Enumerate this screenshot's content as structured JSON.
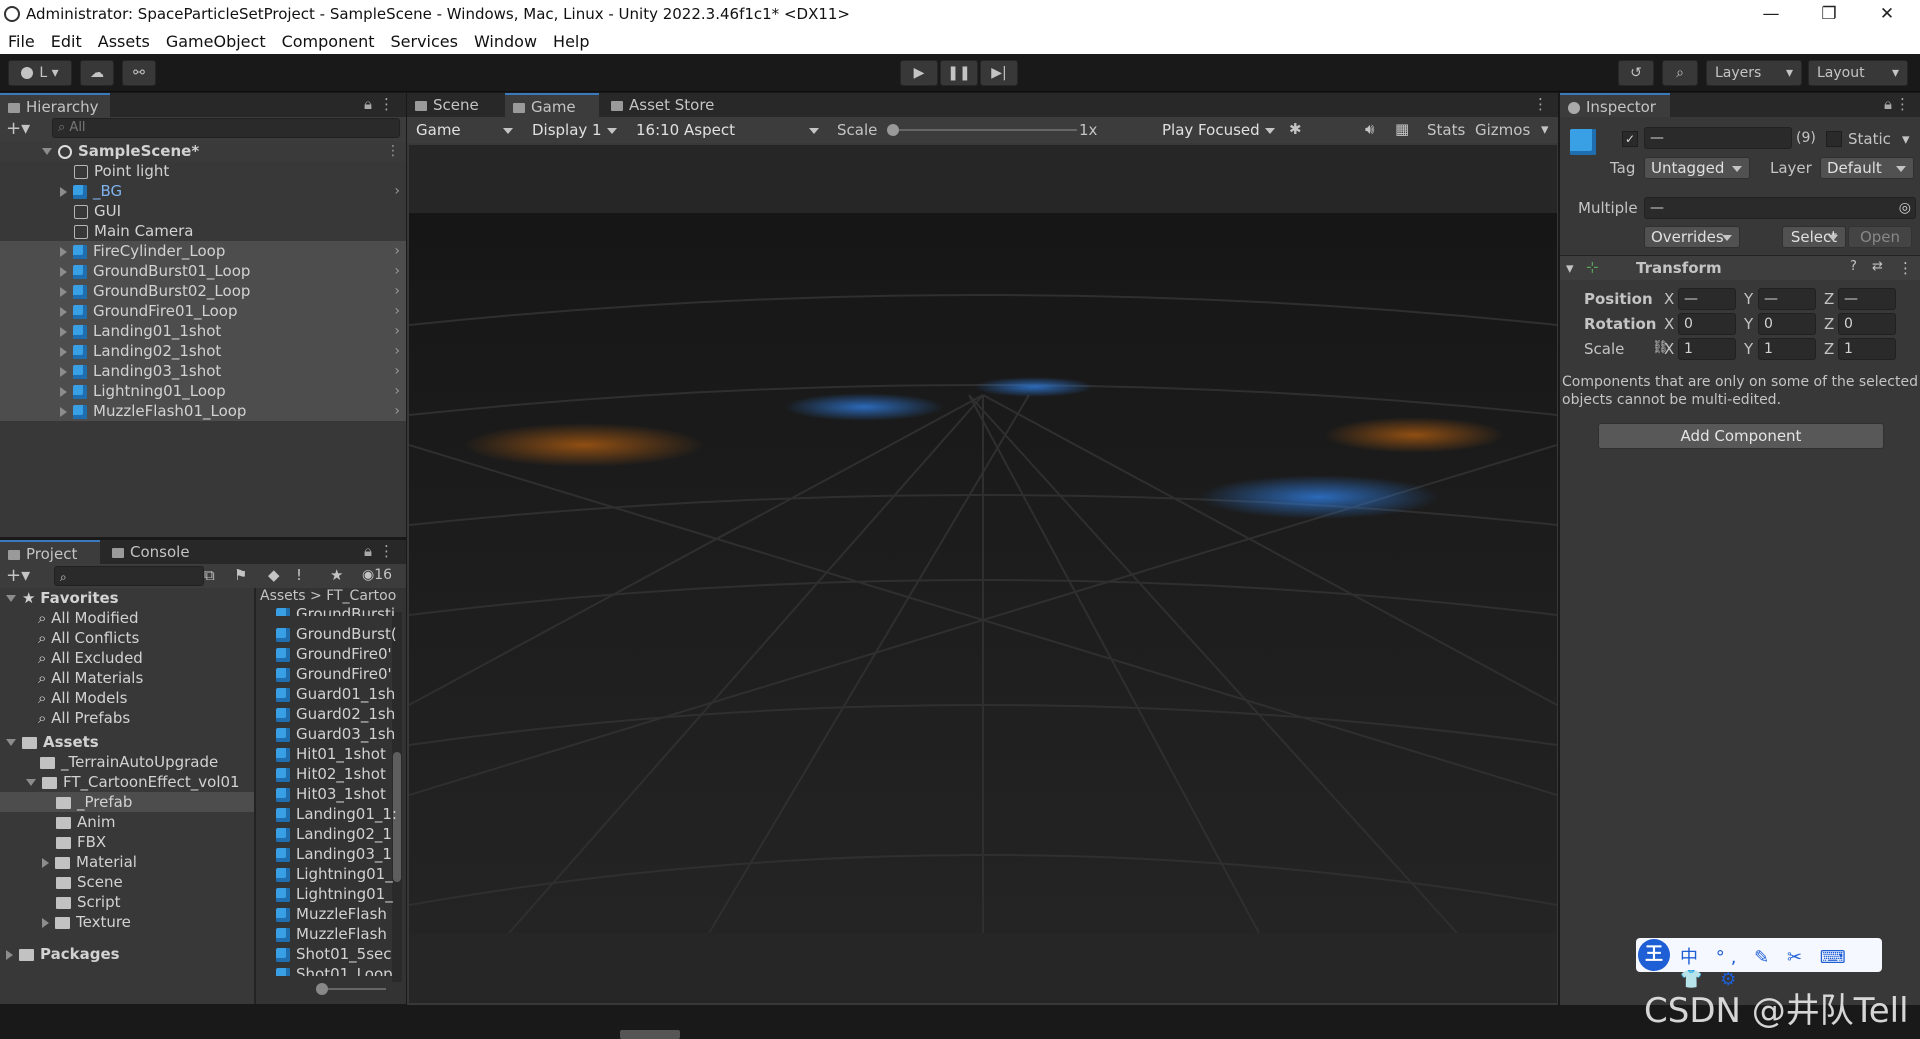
{
  "window": {
    "title": "Administrator: SpaceParticleSetProject - SampleScene - Windows, Mac, Linux - Unity 2022.3.46f1c1* <DX11>",
    "min_icon": "minimize-icon",
    "max_icon": "maximize-icon",
    "close_icon": "close-icon",
    "minimize": "—",
    "maximize": "❐",
    "close": "✕"
  },
  "menu": [
    "File",
    "Edit",
    "Assets",
    "GameObject",
    "Component",
    "Services",
    "Window",
    "Help"
  ],
  "toolbar": {
    "account": "L",
    "layers": "Layers",
    "layout": "Layout"
  },
  "hierarchy": {
    "tab": "Hierarchy",
    "search_placeholder": "All",
    "scene": "SampleScene*",
    "items": [
      {
        "name": "Point light",
        "icon": "gameobject-icon"
      },
      {
        "name": "_BG",
        "icon": "prefab-icon"
      },
      {
        "name": "GUI",
        "icon": "gameobject-icon"
      },
      {
        "name": "Main Camera",
        "icon": "gameobject-icon"
      },
      {
        "name": "FireCylinder_Loop",
        "icon": "prefab-icon"
      },
      {
        "name": "GroundBurst01_Loop",
        "icon": "prefab-icon"
      },
      {
        "name": "GroundBurst02_Loop",
        "icon": "prefab-icon"
      },
      {
        "name": "GroundFire01_Loop",
        "icon": "prefab-icon"
      },
      {
        "name": "Landing01_1shot",
        "icon": "prefab-icon"
      },
      {
        "name": "Landing02_1shot",
        "icon": "prefab-icon"
      },
      {
        "name": "Landing03_1shot",
        "icon": "prefab-icon"
      },
      {
        "name": "Lightning01_Loop",
        "icon": "prefab-icon"
      },
      {
        "name": "MuzzleFlash01_Loop",
        "icon": "prefab-icon"
      }
    ]
  },
  "project": {
    "tab_project": "Project",
    "tab_console": "Console",
    "count": "16",
    "favorites": "Favorites",
    "favorite_items": [
      "All Modified",
      "All Conflicts",
      "All Excluded",
      "All Materials",
      "All Models",
      "All Prefabs"
    ],
    "assets": "Assets",
    "tree": [
      "_TerrainAutoUpgrade",
      "FT_CartoonEffect_vol01",
      "_Prefab",
      "Anim",
      "FBX",
      "Material",
      "Scene",
      "Script",
      "Texture"
    ],
    "packages": "Packages",
    "breadcrumb_root": "Assets",
    "breadcrumb_sep": ">",
    "breadcrumb_child": "FT_Cartoo",
    "grid_items": [
      "GroundBursti",
      "GroundBurst(",
      "GroundFire0'",
      "GroundFire0'",
      "Guard01_1sh",
      "Guard02_1sh",
      "Guard03_1sh",
      "Hit01_1shot",
      "Hit02_1shot",
      "Hit03_1shot",
      "Landing01_1:",
      "Landing02_1",
      "Landing03_1",
      "Lightning01_",
      "Lightning01_",
      "MuzzleFlash",
      "MuzzleFlash",
      "Shot01_5sec",
      "Shot01_Loop"
    ]
  },
  "game": {
    "tab_scene": "Scene",
    "tab_game": "Game",
    "tab_store": "Asset Store",
    "mode": "Game",
    "display": "Display 1",
    "aspect": "16:10 Aspect",
    "scale_label": "Scale",
    "scale_value": "1x",
    "play_focused": "Play Focused",
    "stats": "Stats",
    "gizmos": "Gizmos"
  },
  "inspector": {
    "tab": "Inspector",
    "name_value": "—",
    "count": "(9)",
    "static": "Static",
    "tag_label": "Tag",
    "tag": "Untagged",
    "layer_label": "Layer",
    "layer": "Default",
    "multiple": "Multiple",
    "multiple_value": "—",
    "overrides": "Overrides",
    "select": "Select",
    "open": "Open",
    "transform": "Transform",
    "position": "Position",
    "rotation": "Rotation",
    "scale": "Scale",
    "axes": {
      "x": "X",
      "y": "Y",
      "z": "Z"
    },
    "pos": [
      "—",
      "—",
      "—"
    ],
    "rot": [
      "0",
      "0",
      "0"
    ],
    "scl": [
      "1",
      "1",
      "1"
    ],
    "note": "Components that are only on some of the selected objects cannot be multi-edited.",
    "add_component": "Add Component"
  },
  "ime": {
    "symbols": "中 °, ✎ ✂ ⌨ 👕 ⚙"
  },
  "watermark": "CSDN @井队Tell"
}
